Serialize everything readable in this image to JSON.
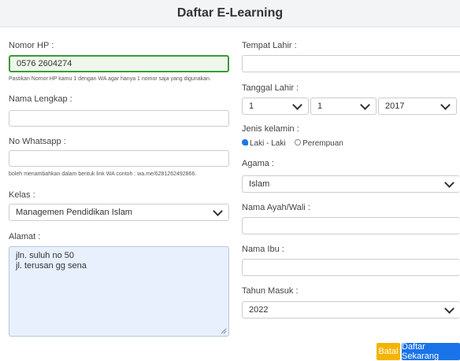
{
  "header": {
    "title": "Daftar E-Learning"
  },
  "left": {
    "phone": {
      "label": "Nomor HP :",
      "value": "0576 2604274",
      "hint": "Pastikan Nomor HP kamu 1 dengan WA agar hanya 1 nomor saja yang digunakan."
    },
    "fullname": {
      "label": "Nama Lengkap :",
      "value": ""
    },
    "whatsapp": {
      "label": "No Whatsapp :",
      "value": "",
      "hint": "boleh menambahkan dalam bentuk link WA contoh : wa.me/6281262492866."
    },
    "kelas": {
      "label": "Kelas :",
      "selected": "Managemen Pendidikan Islam"
    },
    "alamat": {
      "label": "Alamat :",
      "line1": "jln. suluh no 50",
      "line2": "jl. terusan gg sena"
    }
  },
  "right": {
    "tempat_lahir": {
      "label": "Tempat Lahir :",
      "value": ""
    },
    "tanggal_lahir": {
      "label": "Tanggal Lahir :",
      "day": "1",
      "month": "1",
      "year": "2017"
    },
    "gender": {
      "label": "Jenis kelamin :",
      "option_male": "Laki - Laki",
      "option_female": "Perempuan",
      "selected": "Laki - Laki"
    },
    "agama": {
      "label": "Agama :",
      "selected": "Islam"
    },
    "ayah": {
      "label": "Nama Ayah/Wali :",
      "value": ""
    },
    "ibu": {
      "label": "Nama Ibu :",
      "value": ""
    },
    "tahun_masuk": {
      "label": "Tahun Masuk :",
      "selected": "2022"
    }
  },
  "actions": {
    "cancel": "Batal",
    "submit": "Daftar Sekarang"
  },
  "colors": {
    "cancel": "#f4b400",
    "submit": "#1a73e8",
    "valid_border": "#3a9a3a",
    "autofill_bg": "#e8f0fe"
  }
}
